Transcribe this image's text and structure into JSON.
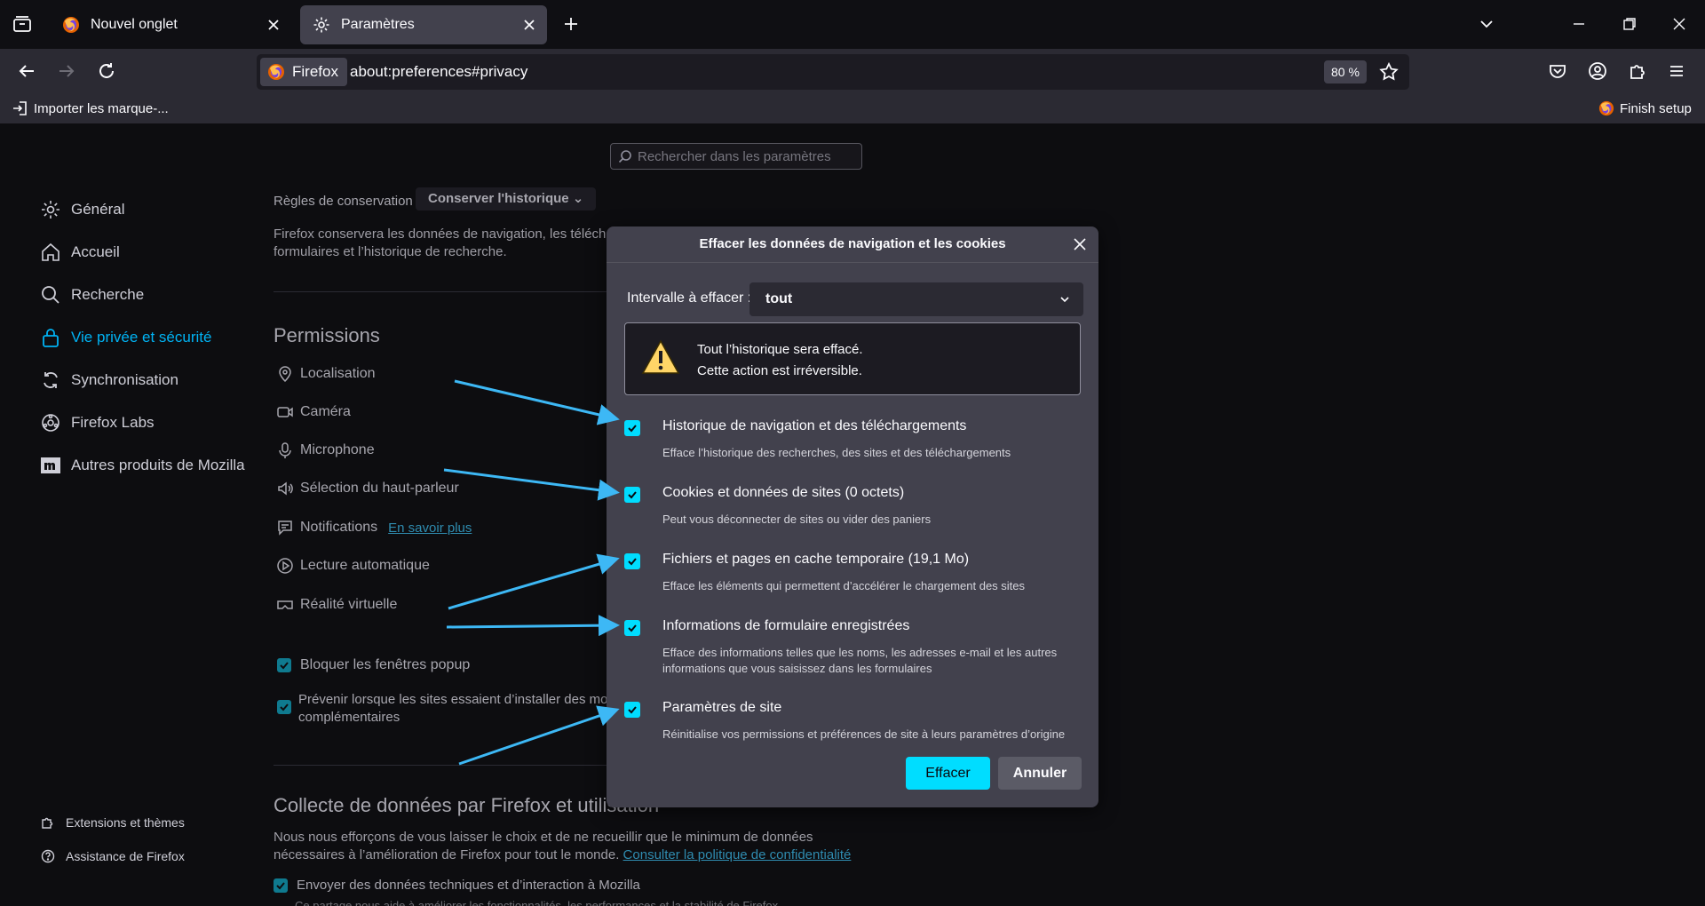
{
  "tabs": [
    {
      "title": "Nouvel onglet",
      "active": false
    },
    {
      "title": "Paramètres",
      "active": true
    }
  ],
  "toolbar": {
    "identity_label": "Firefox",
    "url": "about:preferences#privacy",
    "zoom": "80 %"
  },
  "bookmarks": {
    "import_label": "Importer les marque-...",
    "finish_setup": "Finish setup"
  },
  "search": {
    "placeholder": "Rechercher dans les paramètres"
  },
  "sidebar": {
    "items": [
      {
        "label": "Général",
        "icon": "gear-icon"
      },
      {
        "label": "Accueil",
        "icon": "home-icon"
      },
      {
        "label": "Recherche",
        "icon": "search-icon"
      },
      {
        "label": "Vie privée et sécurité",
        "icon": "lock-icon",
        "active": true
      },
      {
        "label": "Synchronisation",
        "icon": "sync-icon"
      },
      {
        "label": "Firefox Labs",
        "icon": "labs-icon"
      },
      {
        "label": "Autres produits de Mozilla",
        "icon": "mozilla-icon"
      }
    ],
    "footer": [
      {
        "label": "Extensions et thèmes",
        "icon": "puzzle-icon"
      },
      {
        "label": "Assistance de Firefox",
        "icon": "help-icon"
      }
    ]
  },
  "history": {
    "rule_label": "Règles de conservation",
    "rule_value": "Conserver l'historique",
    "desc_line1": "Firefox conservera les données de navigation, les télécha",
    "desc_line2": "formulaires et l’historique de recherche."
  },
  "permissions": {
    "heading": "Permissions",
    "items": [
      {
        "label": "Localisation",
        "icon": "location-icon"
      },
      {
        "label": "Caméra",
        "icon": "camera-icon"
      },
      {
        "label": "Microphone",
        "icon": "microphone-icon"
      },
      {
        "label": "Sélection du haut-parleur",
        "icon": "speaker-icon"
      },
      {
        "label": "Notifications",
        "icon": "notification-icon",
        "link": "En savoir plus"
      },
      {
        "label": "Lecture automatique",
        "icon": "autoplay-icon"
      },
      {
        "label": "Réalité virtuelle",
        "icon": "vr-icon"
      }
    ],
    "block_popups": "Bloquer les fenêtres popup",
    "warn_addons_line1": "Prévenir lorsque les sites essaient d’installer des mod",
    "warn_addons_line2": "complémentaires"
  },
  "data_collection": {
    "heading": "Collecte de données par Firefox et utilisation",
    "desc_line1": "Nous nous efforçons de vous laisser le choix et de ne recueillir que le minimum de données",
    "desc_line2": "nécessaires à l’amélioration de Firefox pour tout le monde.",
    "privacy_link": "Consulter la politique de confidentialité",
    "send_data": "Envoyer des données techniques et d’interaction à Mozilla",
    "cut_line": "Ce partage nous aide à améliorer les fonctionnalités, les performances et la stabilité de Firefox"
  },
  "dialog": {
    "title": "Effacer les données de navigation et les cookies",
    "range_label": "Intervalle à effacer :",
    "range_value": "tout",
    "warning_line1": "Tout l’historique sera effacé.",
    "warning_line2": "Cette action est irréversible.",
    "options": [
      {
        "label": "Historique de navigation et des téléchargements",
        "desc": "Efface l’historique des recherches, des sites et des téléchargements",
        "checked": true
      },
      {
        "label": "Cookies et données de sites (0 octets)",
        "desc": "Peut vous déconnecter de sites ou vider des paniers",
        "checked": true
      },
      {
        "label": "Fichiers et pages en cache temporaire (19,1 Mo)",
        "desc": "Efface les éléments qui permettent d’accélérer le chargement des sites",
        "checked": true
      },
      {
        "label": "Informations de formulaire enregistrées",
        "desc": "Efface des informations telles que les noms, les adresses e-mail et les autres informations que vous saisissez dans les formulaires",
        "checked": true
      },
      {
        "label": "Paramètres de site",
        "desc": "Réinitialise vos permissions et préférences de site à leurs paramètres d’origine",
        "checked": true
      }
    ],
    "clear_button": "Effacer",
    "cancel_button": "Annuler"
  },
  "colors": {
    "accent": "#00ddff",
    "active_nav": "#00b3f4",
    "arrow": "#3db8f5",
    "dialog_bg": "#42414d"
  }
}
